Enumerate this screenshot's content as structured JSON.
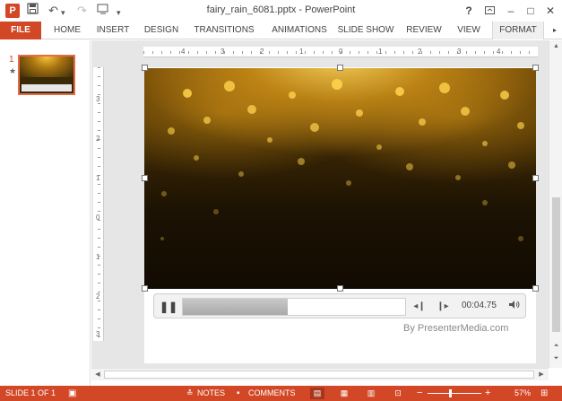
{
  "window": {
    "title": "fairy_rain_6081.pptx - PowerPoint",
    "help": "?",
    "minimize": "–",
    "maximize": "□",
    "close": "✕"
  },
  "app_icon": "P",
  "quick_access": {
    "save_icon": "save-icon",
    "undo": "↶",
    "redo": "↷",
    "customize": "▾"
  },
  "ribbon": {
    "tabs": [
      "FILE",
      "HOME",
      "INSERT",
      "DESIGN",
      "TRANSITIONS",
      "ANIMATIONS",
      "SLIDE SHOW",
      "REVIEW",
      "VIEW",
      "FORMAT"
    ],
    "active_tab": "FORMAT",
    "accent_color": "#d24726"
  },
  "thumbnails": {
    "slide_number": "1",
    "marker": "★"
  },
  "ruler": {
    "horizontal": [
      "4",
      "3",
      "2",
      "1",
      "0",
      "1",
      "2",
      "3",
      "4"
    ],
    "vertical": [
      "3",
      "2",
      "1",
      "0",
      "1",
      "2",
      "3"
    ]
  },
  "player": {
    "pause_icon": "pause-icon",
    "progress_fraction": 0.47,
    "time": "00:04.75",
    "back_icon": "skip-back-icon",
    "forward_icon": "skip-forward-icon",
    "volume_icon": "volume-icon"
  },
  "slide": {
    "credit": "By PresenterMedia.com"
  },
  "status": {
    "slide_indicator": "SLIDE 1 OF 1",
    "notes": "NOTES",
    "comments": "COMMENTS",
    "zoom_level": "57%",
    "zoom_fraction": 0.57,
    "zoom_minus": "−",
    "zoom_plus": "+"
  }
}
